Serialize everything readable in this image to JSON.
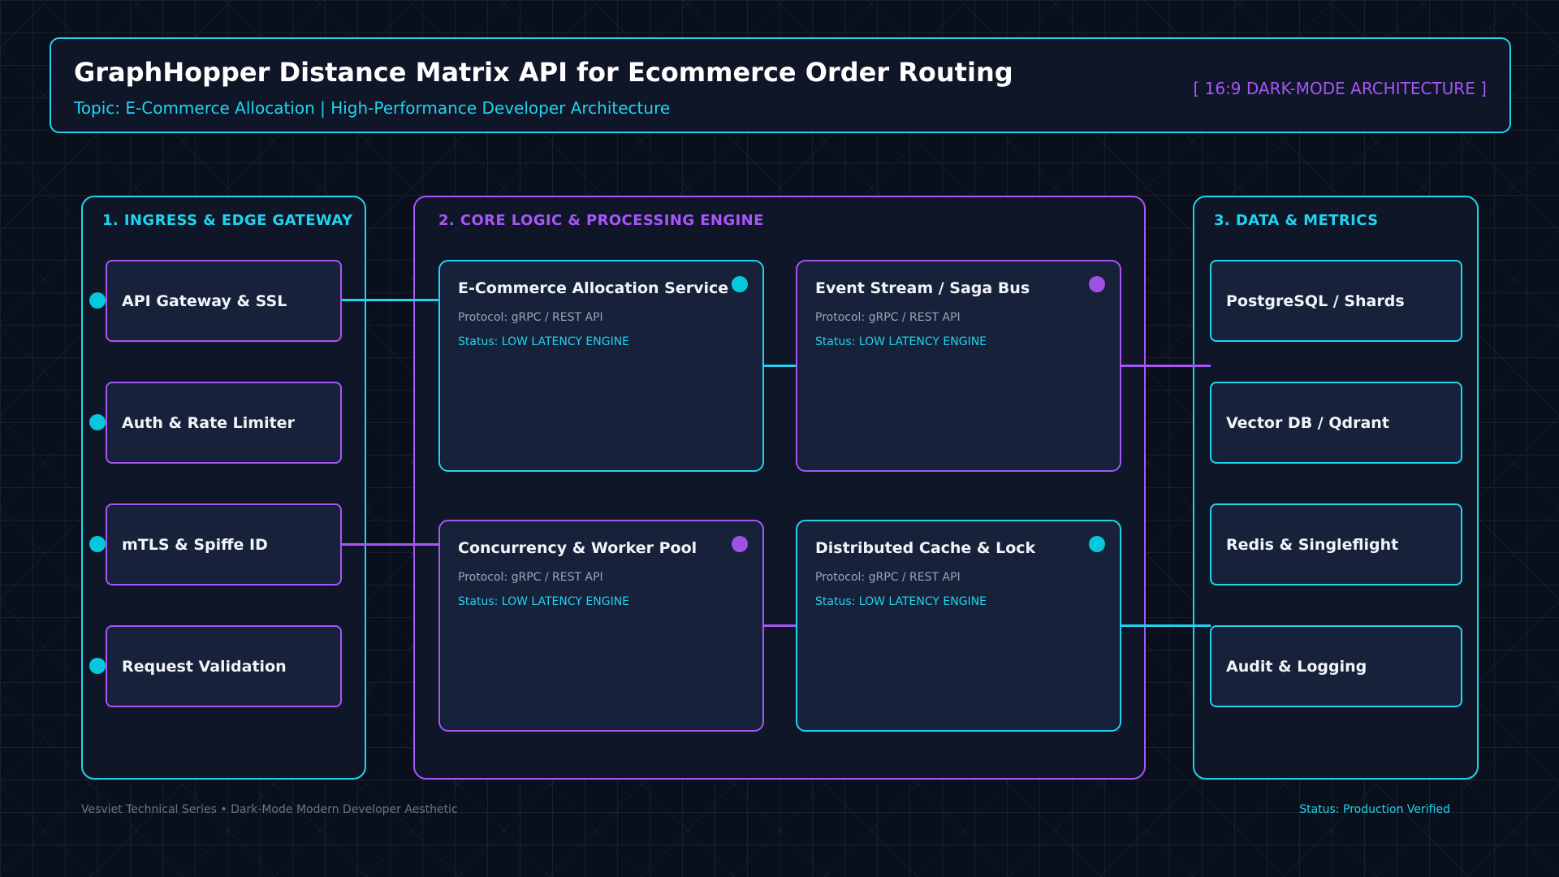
{
  "header": {
    "title": "GraphHopper Distance Matrix API for Ecommerce Order Routing",
    "subtitle": "Topic: E-Commerce Allocation | High-Performance Developer Architecture",
    "badge": "[ 16:9 DARK-MODE ARCHITECTURE ]"
  },
  "sections": {
    "ingress": {
      "title": "1. INGRESS & EDGE GATEWAY",
      "items": [
        {
          "label": "API Gateway & SSL"
        },
        {
          "label": "Auth & Rate Limiter"
        },
        {
          "label": "mTLS & Spiffe ID"
        },
        {
          "label": "Request Validation"
        }
      ]
    },
    "core": {
      "title": "2. CORE LOGIC & PROCESSING ENGINE",
      "cards": [
        {
          "title": "E-Commerce Allocation Service",
          "protocol": "Protocol: gRPC / REST API",
          "status": "Status: LOW LATENCY ENGINE"
        },
        {
          "title": "Event Stream / Saga Bus",
          "protocol": "Protocol: gRPC / REST API",
          "status": "Status: LOW LATENCY ENGINE"
        },
        {
          "title": "Concurrency & Worker Pool",
          "protocol": "Protocol: gRPC / REST API",
          "status": "Status: LOW LATENCY ENGINE"
        },
        {
          "title": "Distributed Cache & Lock",
          "protocol": "Protocol: gRPC / REST API",
          "status": "Status: LOW LATENCY ENGINE"
        }
      ]
    },
    "data": {
      "title": "3. DATA & METRICS",
      "items": [
        {
          "label": "PostgreSQL / Shards"
        },
        {
          "label": "Vector DB / Qdrant"
        },
        {
          "label": "Redis & Singleflight"
        },
        {
          "label": "Audit & Logging"
        }
      ]
    }
  },
  "footer": {
    "left": "Vesviet Technical Series • Dark-Mode Modern Developer Aesthetic",
    "right": "Status: Production Verified"
  },
  "colors": {
    "cyan": "#22d3ee",
    "purple": "#a855f7",
    "background": "#0a101b",
    "panel": "#0e1628",
    "card": "#17213a"
  }
}
